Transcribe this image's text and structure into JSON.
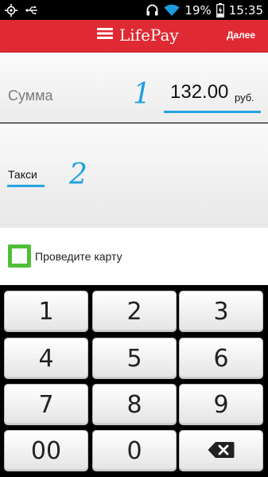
{
  "status_bar": {
    "battery": "19%",
    "time": "15:35",
    "icons": [
      "gps-icon",
      "usb-icon",
      "headset-icon",
      "wifi-icon",
      "battery-icon"
    ]
  },
  "header": {
    "title": "LifePay",
    "next_label": "Далее",
    "background_color": "#e02a33"
  },
  "amount": {
    "label": "Сумма",
    "value": "132.00",
    "currency": "руб.",
    "step_marker": "1"
  },
  "description": {
    "value": "Такси",
    "step_marker": "2"
  },
  "card": {
    "prompt": "Проведите карту",
    "icon_color": "#4fbf3a"
  },
  "keypad": {
    "keys": [
      "1",
      "2",
      "3",
      "4",
      "5",
      "6",
      "7",
      "8",
      "9",
      "00",
      "0"
    ],
    "backspace_icon": "backspace-icon"
  },
  "accent_color": "#27a3e0"
}
